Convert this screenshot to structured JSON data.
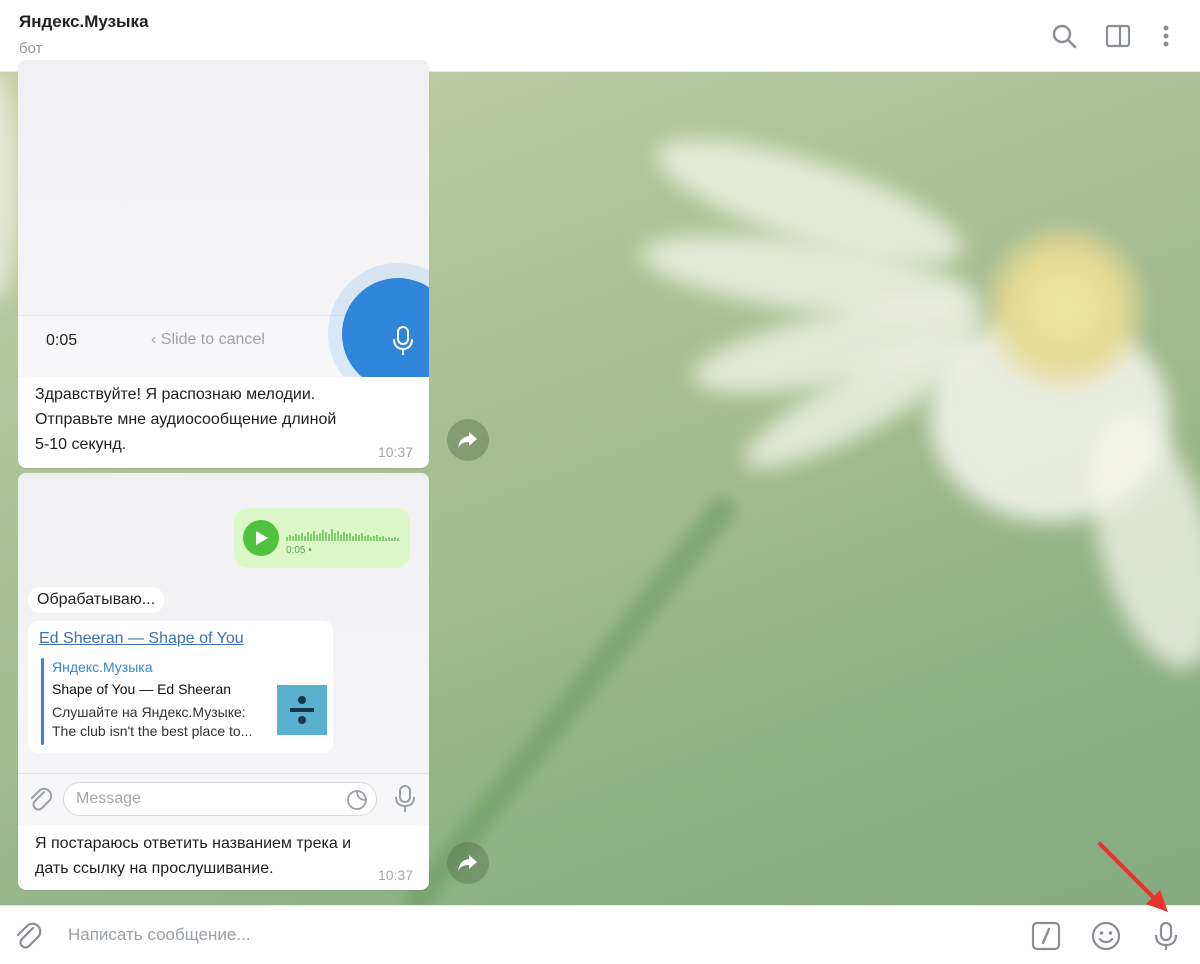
{
  "header": {
    "title": "Яндекс.Музыка",
    "subtitle": "бот",
    "icons": [
      "search-icon",
      "sidebar-toggle-icon",
      "more-vertical-icon"
    ]
  },
  "messages": [
    {
      "screenshot": {
        "recording_time": "0:05",
        "slide_to_cancel": "Slide to cancel"
      },
      "text_lines": [
        "Здравствуйте! Я распознаю мелодии.",
        "Отправьте мне аудиосообщение длиной",
        "5-10 секунд."
      ],
      "time": "10:37"
    },
    {
      "screenshot": {
        "voice_duration": "0:05 •",
        "processing_text": "Обрабатываю...",
        "reply_link": "Ed Sheeran — Shape of You",
        "preview_site": "Яндекс.Музыка",
        "preview_title": "Shape of You — Ed Sheeran",
        "preview_desc_lines": [
          "Слушайте на Яндекс.Музыке:",
          "The club isn't the best place to..."
        ],
        "input_placeholder": "Message"
      },
      "text_lines": [
        "Я постараюсь ответить названием трека и",
        "дать ссылку на прослушивание."
      ],
      "time": "10:37"
    }
  ],
  "composer": {
    "placeholder": "Написать сообщение...",
    "icons": [
      "attach-icon",
      "bot-command-icon",
      "emoji-icon",
      "microphone-icon"
    ]
  },
  "colors": {
    "accent": "#2f85da",
    "link": "#3a72b6",
    "voice_bubble": "#dcf8c6",
    "annotation_arrow": "#e8342a"
  }
}
